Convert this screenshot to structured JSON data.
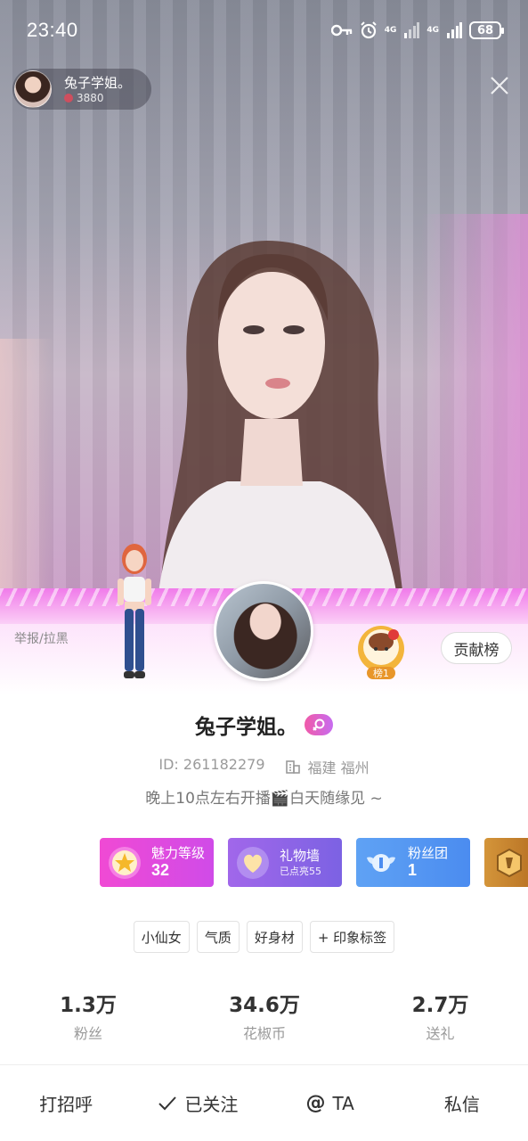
{
  "status_bar": {
    "time": "23:40",
    "net1": "4G",
    "net2": "4G",
    "battery": "68",
    "icons": [
      "key-icon",
      "alarm-icon",
      "signal-icon",
      "signal-icon",
      "battery-icon"
    ]
  },
  "streamer": {
    "name": "兔子学姐。",
    "score": "3880"
  },
  "profile": {
    "report_label": "举报/拉黑",
    "rank_badge_label": "榜1",
    "contrib_label": "贡献榜",
    "name": "兔子学姐。",
    "id_text": "ID: 261182279",
    "location": "福建 福州",
    "bio": "晚上10点左右开播🎬白天随缘见 ~"
  },
  "features": {
    "charm": {
      "title": "魅力等级",
      "value": "32"
    },
    "gift": {
      "title": "礼物墙",
      "sub": "已点亮55"
    },
    "fans": {
      "title": "粉丝团",
      "value": "1"
    }
  },
  "tags": [
    "小仙女",
    "气质",
    "好身材",
    "+ 印象标签"
  ],
  "stats": [
    {
      "value": "1.3万",
      "label": "粉丝"
    },
    {
      "value": "34.6万",
      "label": "花椒币"
    },
    {
      "value": "2.7万",
      "label": "送礼"
    }
  ],
  "actions": {
    "greet": "打招呼",
    "followed": "已关注",
    "at_ta": "TA",
    "message": "私信"
  },
  "colors": {
    "charm": "#e64ad8",
    "gift": "#8f65e6",
    "fans": "#559af2",
    "pink_band": "#f07bea"
  }
}
